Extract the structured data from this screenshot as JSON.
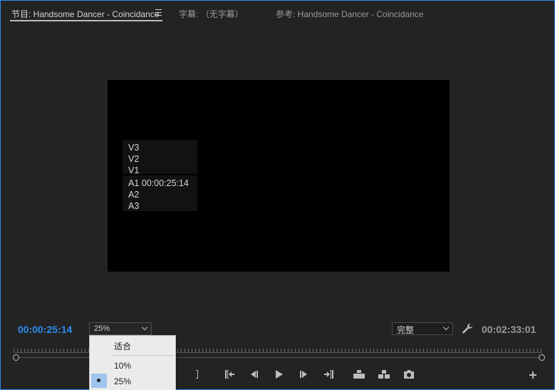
{
  "tabs": [
    {
      "label": "节目: Handsome Dancer - Coincidance",
      "active": true
    },
    {
      "label": "字幕: （无字幕）",
      "active": false
    },
    {
      "label": "参考: Handsome Dancer - Coincidance",
      "active": false
    }
  ],
  "overlay": {
    "video_tracks": [
      "V3",
      "V2",
      "V1"
    ],
    "audio_tracks": [
      "A1 00:00:25:14",
      "A2",
      "A3"
    ]
  },
  "playhead_timecode": "00:00:25:14",
  "duration_timecode": "00:02:33:01",
  "zoom": {
    "selected": "25%",
    "options": [
      "适合",
      "10%",
      "25%"
    ]
  },
  "playback_resolution": "完整",
  "colors": {
    "accent": "#2d8ceb",
    "panel_bg": "#232323",
    "dropdown_highlight": "#9fc5ee"
  },
  "icons": [
    "menu-icon",
    "wrench-icon",
    "mark-out-icon",
    "go-to-in-icon",
    "step-back-icon",
    "play-icon",
    "step-forward-icon",
    "go-to-out-icon",
    "lift-icon",
    "extract-icon",
    "export-frame-icon",
    "add-button-icon"
  ]
}
